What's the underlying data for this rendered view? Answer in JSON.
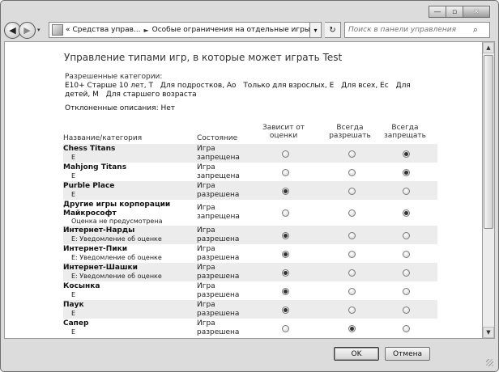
{
  "window": {
    "minimize_glyph": "—",
    "maximize_glyph": "▫",
    "close_glyph": "✕"
  },
  "nav": {
    "back_glyph": "◀",
    "forward_glyph": "▶",
    "history_glyph": "▾",
    "breadcrumb_prefix": "«",
    "breadcrumb": [
      "Средства управ...",
      "Особые ограничения на отдельные игры"
    ],
    "breadcrumb_sep": "►",
    "address_drop_glyph": "▾",
    "refresh_glyph": "↻",
    "search_placeholder": "Поиск в панели управления",
    "search_icon": "search-icon"
  },
  "page": {
    "title": "Управление типами игр, в которые может играть Test",
    "allowed_label": "Разрешенные категории:",
    "allowed_items": [
      "E10+ Старше 10 лет, Т",
      "Для подростков, Ao",
      "Только для взрослых, E",
      "Для всех, Ec",
      "Для детей, M",
      "Для старшего возраста"
    ],
    "rejected_line": "Отклоненные описания:  Нет"
  },
  "table": {
    "headers": {
      "name": "Название/категория",
      "state": "Состояние",
      "depends": "Зависит от оценки",
      "always_allow": "Всегда разрешать",
      "always_block": "Всегда запрещать"
    },
    "rows": [
      {
        "name": "Chess Titans",
        "rating": "E",
        "state": "Игра запрещена",
        "choice": 3
      },
      {
        "name": "Mahjong Titans",
        "rating": "E",
        "state": "Игра запрещена",
        "choice": 3
      },
      {
        "name": "Purble Place",
        "rating": "E",
        "state": "Игра разрешена",
        "choice": 1
      },
      {
        "name": "Другие игры корпорации Майкрософт",
        "rating": "Оценка не предусмотрена",
        "state": "Игра запрещена",
        "choice": 3
      },
      {
        "name": "Интернет-Нарды",
        "rating": "E: Уведомление об оценке",
        "state": "Игра разрешена",
        "choice": 1
      },
      {
        "name": "Интернет-Пики",
        "rating": "E: Уведомление об оценке",
        "state": "Игра разрешена",
        "choice": 1
      },
      {
        "name": "Интернет-Шашки",
        "rating": "E: Уведомление об оценке",
        "state": "Игра разрешена",
        "choice": 1
      },
      {
        "name": "Косынка",
        "rating": "E",
        "state": "Игра разрешена",
        "choice": 1
      },
      {
        "name": "Паук",
        "rating": "E",
        "state": "Игра разрешена",
        "choice": 1
      },
      {
        "name": "Сапер",
        "rating": "E",
        "state": "Игра разрешена",
        "choice": 2
      }
    ]
  },
  "buttons": {
    "ok": "OK",
    "cancel": "Отмена"
  },
  "scrollbar": {
    "up_glyph": "▲",
    "down_glyph": "▼"
  }
}
